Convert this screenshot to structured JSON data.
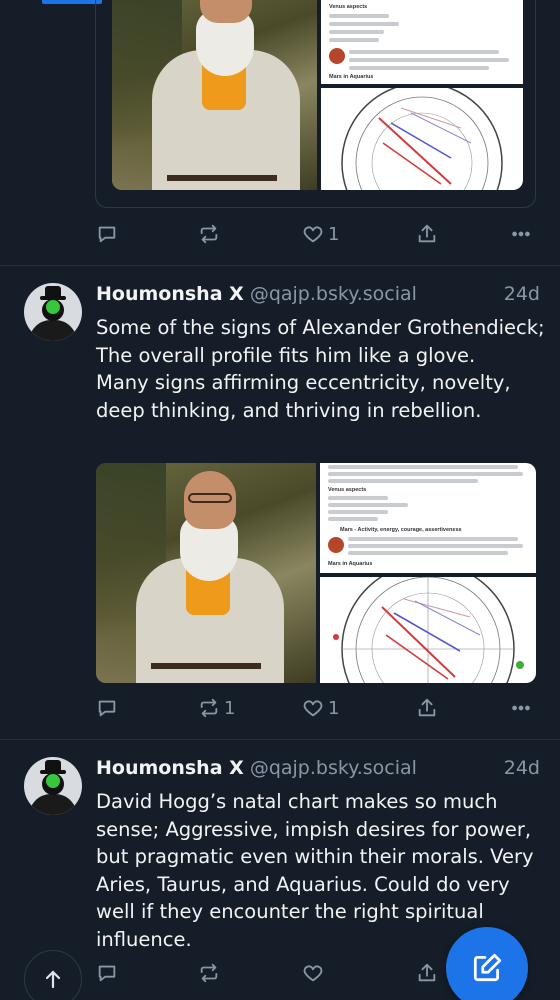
{
  "feed": {
    "posts": [
      {
        "likes": "1",
        "reposts": "",
        "replies": ""
      },
      {
        "display_name": "Houmonsha X",
        "handle": "@qajp.bsky.social",
        "time": "24d",
        "text": "Some of the signs of Alexander Grothendieck; The overall profile fits him like a glove.\nMany signs affirming eccentricity, novelty, deep thinking, and thriving in rebellion.",
        "replies": "",
        "reposts": "1",
        "likes": "1",
        "doc": {
          "venus_heading": "Venus aspects",
          "mars_heading": "Mars - Activity, energy, courage, assertiveness",
          "mars_in": "Mars in Aquarius"
        }
      },
      {
        "display_name": "Houmonsha X",
        "handle": "@qajp.bsky.social",
        "time": "24d",
        "text": "David Hogg’s natal chart makes so much sense; Aggressive, impish desires for power, but pragmatic even within their morals. Very Aries, Taurus, and Aquarius. Could do very well if they encounter the right spiritual influence.",
        "replies": "",
        "reposts": "",
        "likes": ""
      }
    ]
  },
  "icons": {
    "reply": "speech-bubble-icon",
    "repost": "repost-arrows-icon",
    "like": "heart-icon",
    "share": "share-upload-icon",
    "more": "ellipsis-icon",
    "compose": "pencil-square-icon",
    "scroll_top": "arrow-up-icon"
  },
  "colors": {
    "background": "#151e28",
    "accent": "#1d74e8",
    "muted_text": "#8996a5",
    "divider": "#26303c"
  }
}
